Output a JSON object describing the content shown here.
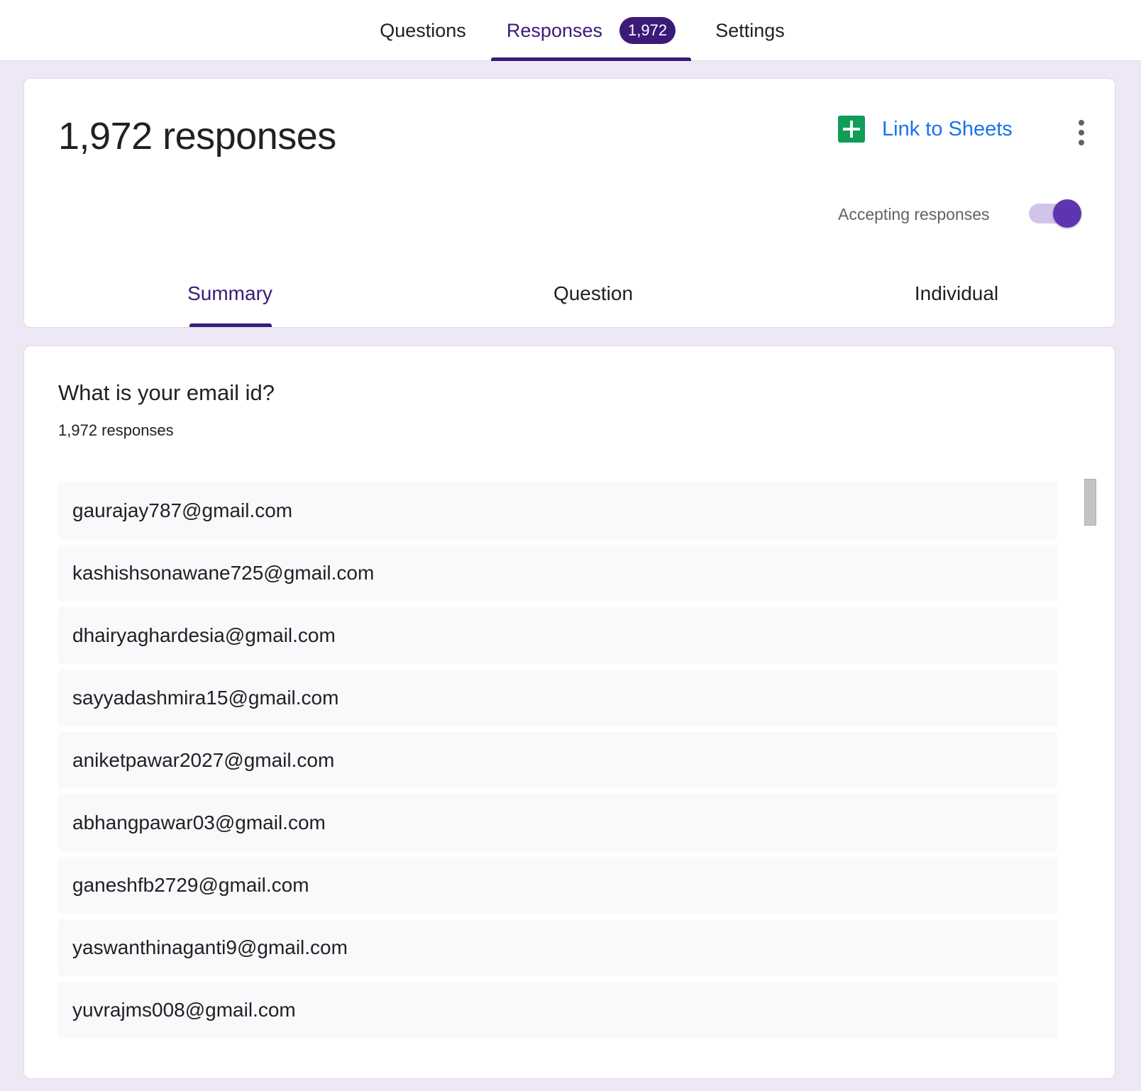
{
  "top_tabs": {
    "questions": "Questions",
    "responses": "Responses",
    "responses_badge": "1,972",
    "settings": "Settings"
  },
  "header": {
    "title": "1,972 responses",
    "link_to_sheets": "Link to Sheets",
    "accepting_label": "Accepting responses",
    "accepting_on": true
  },
  "sub_tabs": {
    "summary": "Summary",
    "question": "Question",
    "individual": "Individual"
  },
  "summary": {
    "question": "What is your email id?",
    "count": "1,972 responses",
    "answers": [
      "gaurajay787@gmail.com",
      "kashishsonawane725@gmail.com",
      "dhairyaghardesia@gmail.com",
      "sayyadashmira15@gmail.com",
      "aniketpawar2027@gmail.com",
      "abhangpawar03@gmail.com",
      "ganeshfb2729@gmail.com",
      "yaswanthinaganti9@gmail.com",
      "yuvrajms008@gmail.com"
    ]
  },
  "colors": {
    "accent": "#3c1a78",
    "page_bg": "#ede7f6",
    "link": "#1a73e8",
    "sheets_green": "#0f9d58",
    "toggle_knob": "#5e35b1",
    "toggle_track": "#d1c4e9"
  },
  "icons": {
    "sheets": "google-sheets-icon",
    "more": "more-vert-icon"
  }
}
